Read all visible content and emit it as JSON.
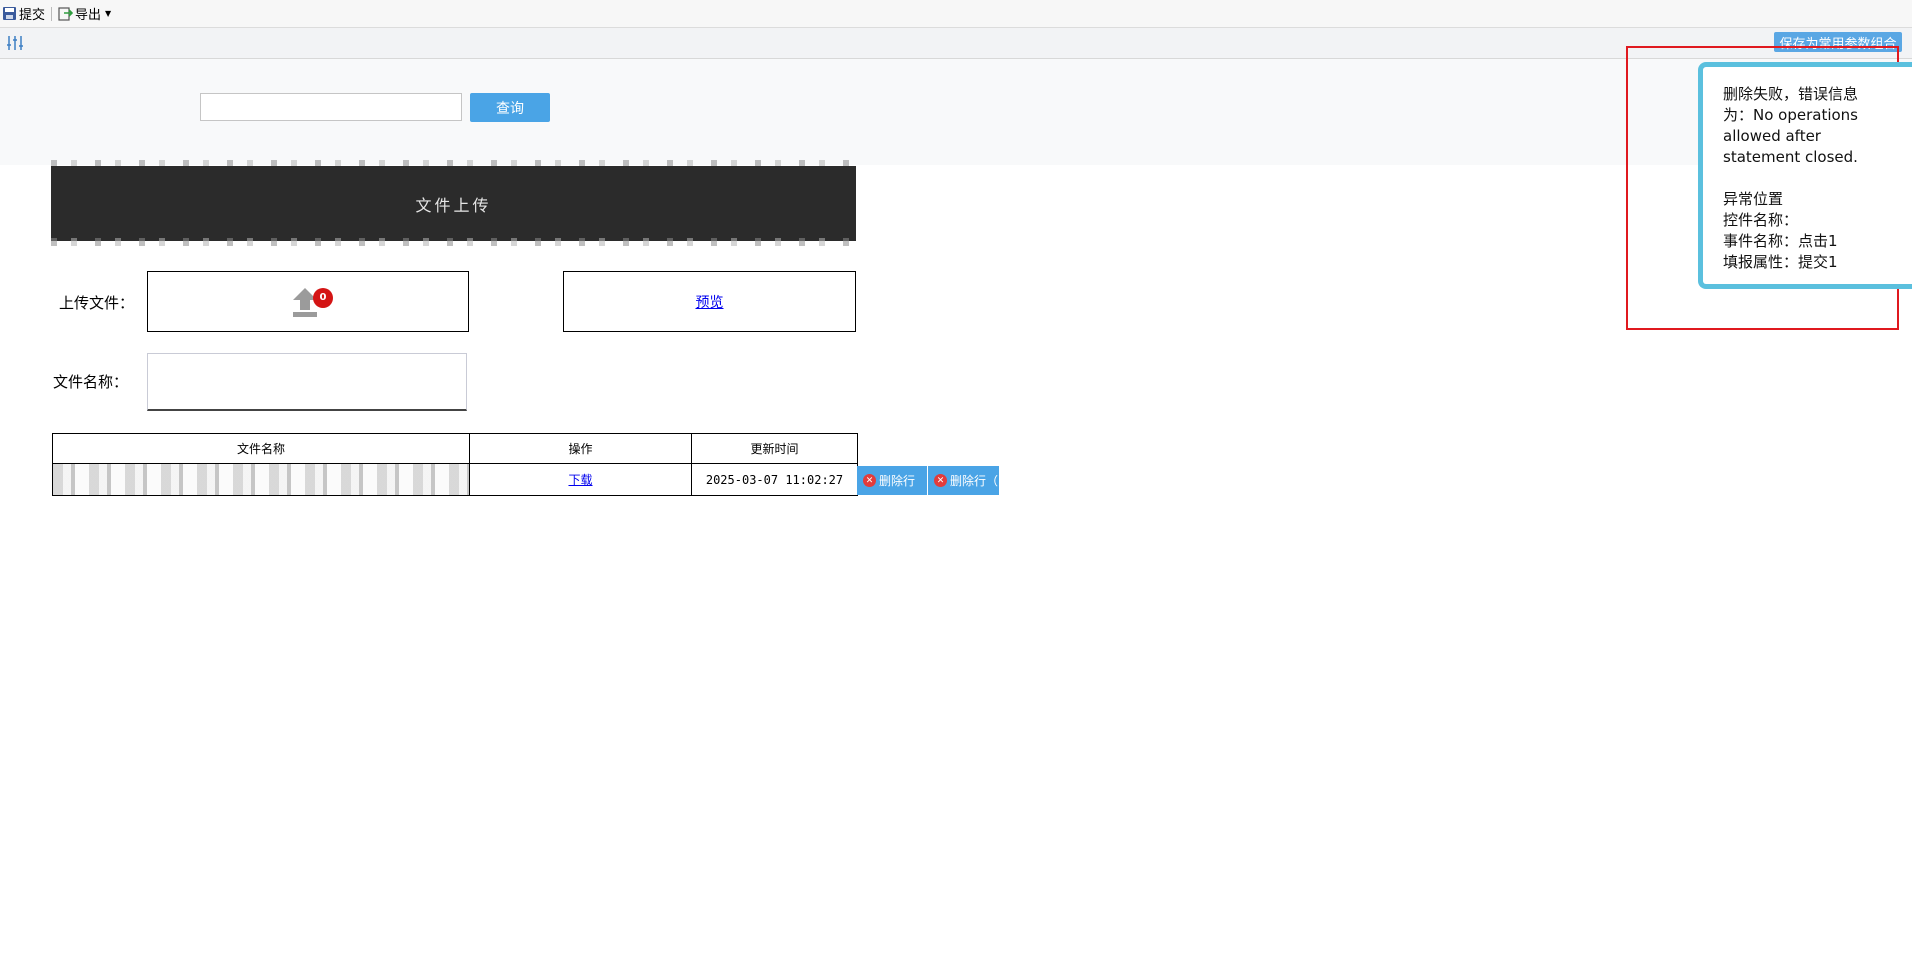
{
  "toolbar": {
    "submit_label": "提交",
    "export_label": "导出"
  },
  "parambar": {
    "save_params_label": "保存为常用参数组合"
  },
  "query": {
    "input_value": "",
    "button_label": "查询"
  },
  "banner": {
    "title": "文件上传"
  },
  "form": {
    "upload_label": "上传文件：",
    "upload_count": "0",
    "preview_link": "预览",
    "filename_label": "文件名称：",
    "filename_value": ""
  },
  "table": {
    "headers": [
      "文件名称",
      "操作",
      "更新时间"
    ],
    "rows": [
      {
        "filename": "",
        "action": "下载",
        "updated": "2025-03-07 11:02:27"
      }
    ],
    "row_actions": [
      "删除行",
      "删除行（附"
    ]
  },
  "error_popup": {
    "line1": "删除失败，错误信息",
    "line2": "为：No operations",
    "line3": "allowed after",
    "line4": "statement closed.",
    "loc_title": "异常位置",
    "control_name": "控件名称：",
    "event_name": "事件名称：点击1",
    "report_attr": "填报属性：提交1"
  },
  "colors": {
    "accent_blue": "#4aa4e6",
    "tooltip_border": "#5bc0de",
    "highlight_red": "#e0191f"
  }
}
